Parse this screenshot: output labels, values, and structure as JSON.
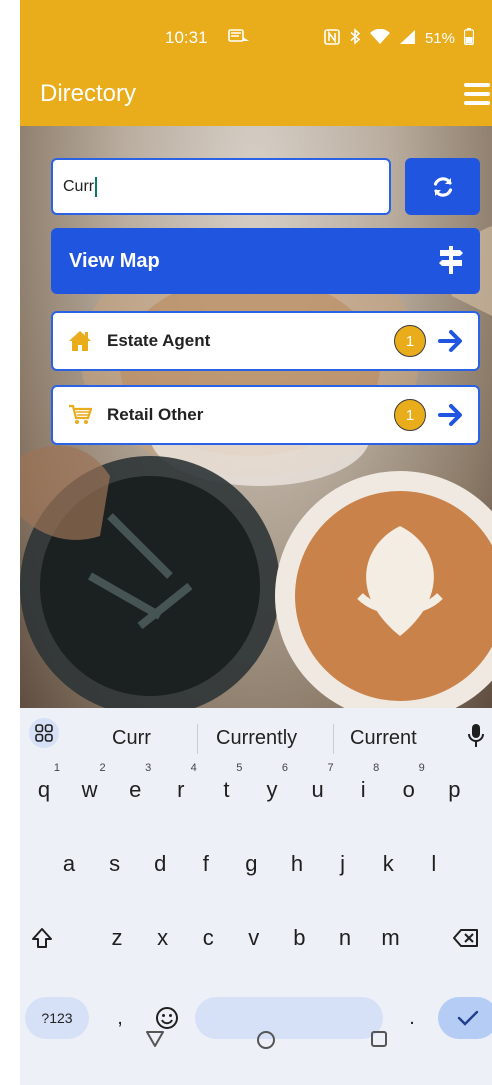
{
  "status": {
    "time": "10:31",
    "battery": "51%"
  },
  "app": {
    "title": "Directory"
  },
  "search": {
    "value": "Curr"
  },
  "view_map": {
    "label": "View Map"
  },
  "categories": [
    {
      "label": "Estate Agent",
      "count": "1",
      "icon": "house-icon"
    },
    {
      "label": "Retail Other",
      "count": "1",
      "icon": "cart-icon"
    }
  ],
  "keyboard": {
    "suggestions": [
      "Curr",
      "Currently",
      "Current"
    ],
    "row1": [
      {
        "key": "q",
        "hint": "1"
      },
      {
        "key": "w",
        "hint": "2"
      },
      {
        "key": "e",
        "hint": "3"
      },
      {
        "key": "r",
        "hint": "4"
      },
      {
        "key": "t",
        "hint": "5"
      },
      {
        "key": "y",
        "hint": "6"
      },
      {
        "key": "u",
        "hint": "7"
      },
      {
        "key": "i",
        "hint": "8"
      },
      {
        "key": "o",
        "hint": "9"
      },
      {
        "key": "p",
        "hint": ""
      }
    ],
    "row2": [
      "a",
      "s",
      "d",
      "f",
      "g",
      "h",
      "j",
      "k",
      "l"
    ],
    "row3": [
      "z",
      "x",
      "c",
      "v",
      "b",
      "n",
      "m"
    ],
    "symbols_label": "?123",
    "comma": ",",
    "period": "."
  },
  "colors": {
    "accent": "#e9ac1b",
    "primary_button": "#2055e0",
    "border": "#2a62e6"
  }
}
